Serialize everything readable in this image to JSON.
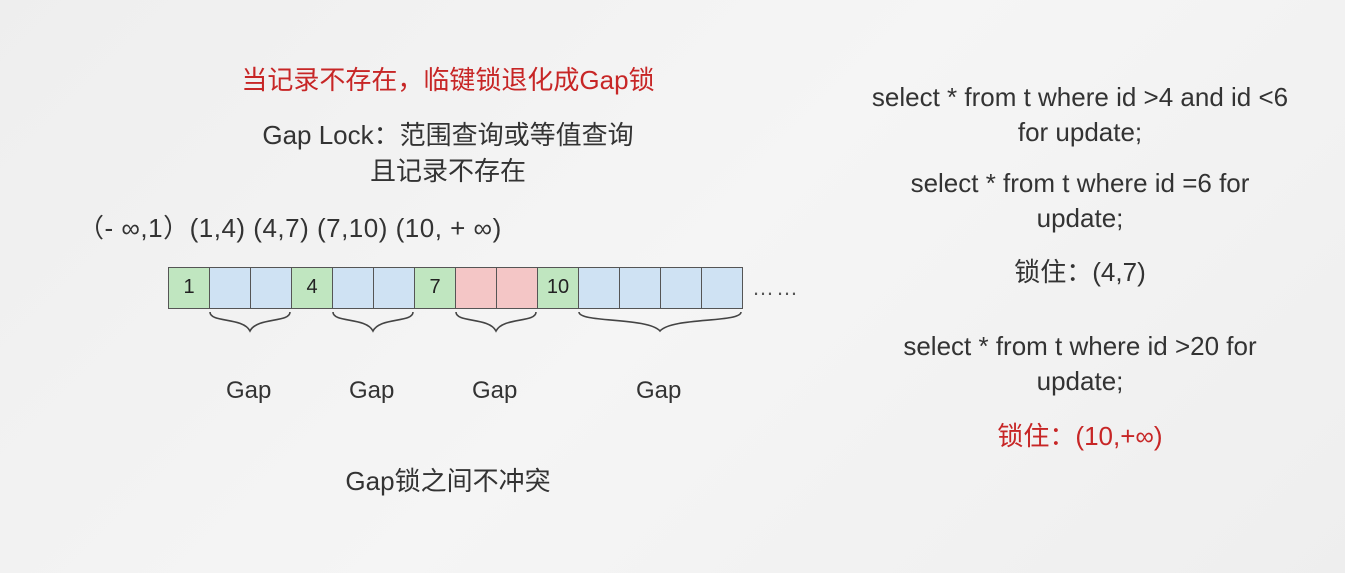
{
  "left": {
    "title": "当记录不存在，临键锁退化成Gap锁",
    "subtitle_line1": "Gap Lock：范围查询或等值查询",
    "subtitle_line2": "且记录不存在",
    "intervals": "（- ∞,1）(1,4) (4,7) (7,10) (10,  + ∞)",
    "cells": [
      {
        "v": "1",
        "c": "green"
      },
      {
        "v": "",
        "c": "blue"
      },
      {
        "v": "",
        "c": "blue"
      },
      {
        "v": "4",
        "c": "green"
      },
      {
        "v": "",
        "c": "blue"
      },
      {
        "v": "",
        "c": "blue"
      },
      {
        "v": "7",
        "c": "green"
      },
      {
        "v": "",
        "c": "pink"
      },
      {
        "v": "",
        "c": "pink"
      },
      {
        "v": "10",
        "c": "green"
      },
      {
        "v": "",
        "c": "blue"
      },
      {
        "v": "",
        "c": "blue"
      },
      {
        "v": "",
        "c": "blue"
      },
      {
        "v": "",
        "c": "blue"
      }
    ],
    "ellipsis": "……",
    "gaps": [
      "Gap",
      "Gap",
      "Gap",
      "Gap"
    ],
    "footer": "Gap锁之间不冲突"
  },
  "right": {
    "sql1": "select * from t where id >4 and id <6 for update;",
    "sql2": "select * from t where id =6 for update;",
    "lock1": "锁住：(4,7)",
    "sql3": "select * from t where id >20 for update;",
    "lock2": "锁住：(10,+∞)"
  }
}
